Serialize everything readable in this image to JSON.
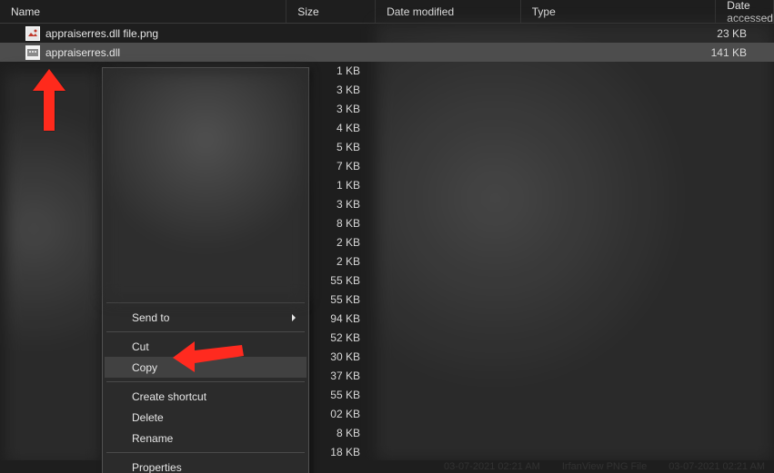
{
  "columns": {
    "name": "Name",
    "size": "Size",
    "modified": "Date modified",
    "type": "Type",
    "accessed": "Date accessed"
  },
  "files": [
    {
      "name": "appraiserres.dll file.png",
      "size": "23 KB",
      "icon": "image-irfanview"
    },
    {
      "name": "appraiserres.dll",
      "size": "141 KB",
      "icon": "dll",
      "selected": true
    }
  ],
  "obscured_sizes": [
    "1 KB",
    "3 KB",
    "3 KB",
    "4 KB",
    "5 KB",
    "7 KB",
    "1 KB",
    "3 KB",
    "8 KB",
    "2 KB",
    "2 KB",
    "55 KB",
    "55 KB",
    "94 KB",
    "52 KB",
    "30 KB",
    "37 KB",
    "55 KB",
    "02 KB",
    "8 KB",
    "18 KB"
  ],
  "context_menu": {
    "send_to": "Send to",
    "cut": "Cut",
    "copy": "Copy",
    "create_shortcut": "Create shortcut",
    "delete": "Delete",
    "rename": "Rename",
    "properties": "Properties"
  },
  "status_bar": {
    "text_left": "03-07-2021 02:21 AM",
    "text_mid": "IrfanView PNG File",
    "text_right": "03-07-2021 02:21 AM"
  },
  "colors": {
    "arrow": "#ff2a1f"
  }
}
